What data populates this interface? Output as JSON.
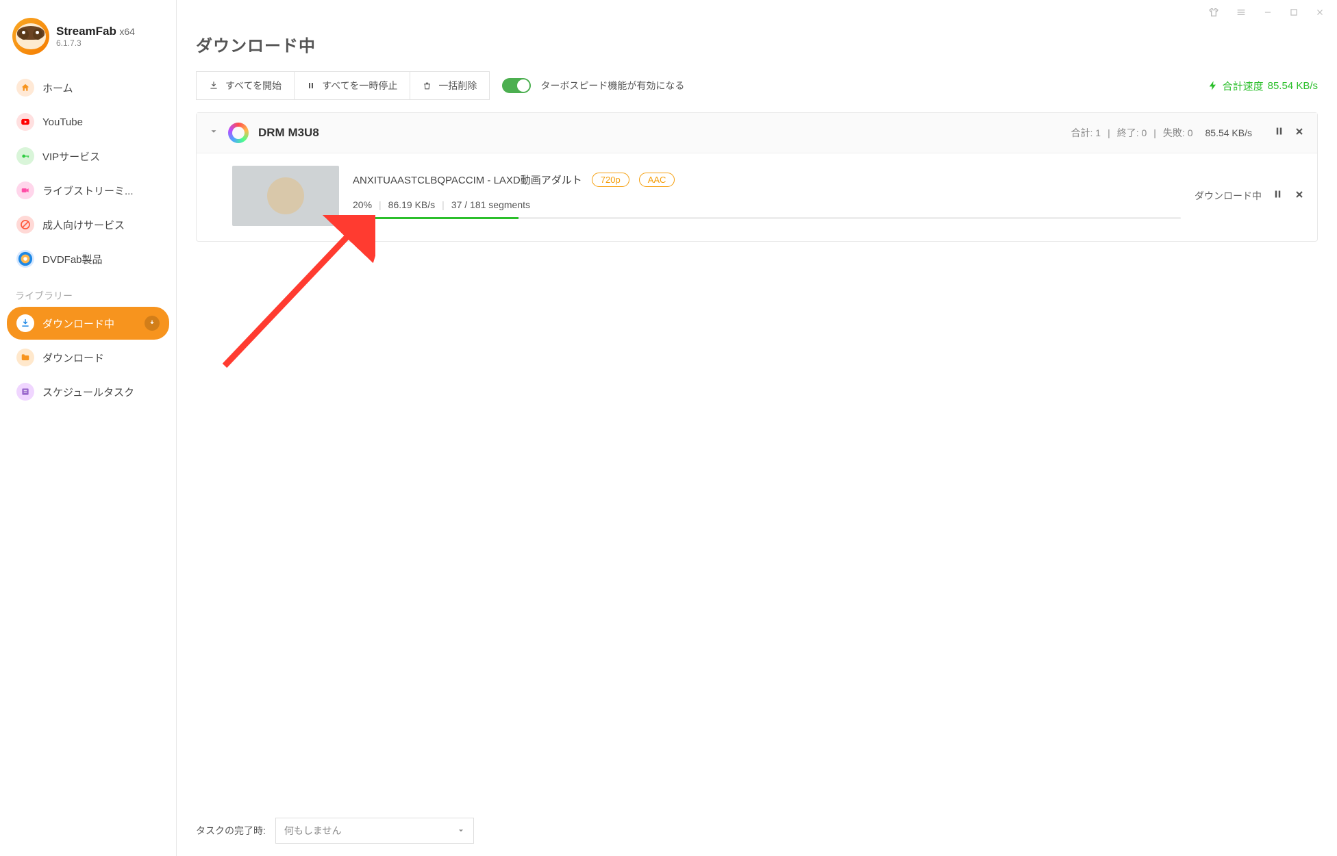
{
  "app": {
    "name": "StreamFab",
    "arch": "x64",
    "version": "6.1.7.3"
  },
  "sidebar": {
    "section_library": "ライブラリー",
    "items": [
      {
        "label": "ホーム"
      },
      {
        "label": "YouTube"
      },
      {
        "label": "VIPサービス"
      },
      {
        "label": "ライブストリーミ..."
      },
      {
        "label": "成人向けサービス"
      },
      {
        "label": "DVDFab製品"
      }
    ],
    "library": [
      {
        "label": "ダウンロード中"
      },
      {
        "label": "ダウンロード"
      },
      {
        "label": "スケジュールタスク"
      }
    ]
  },
  "page": {
    "title": "ダウンロード中"
  },
  "toolbar": {
    "start_all": "すべてを開始",
    "pause_all": "すべてを一時停止",
    "delete_all": "一括削除",
    "turbo_label": "ターボスピード機能が有効になる",
    "total_speed_label": "合計速度",
    "total_speed_value": "85.54 KB/s"
  },
  "group": {
    "name": "DRM M3U8",
    "stats": {
      "total_label": "合計:",
      "total": "1",
      "done_label": "終了:",
      "done": "0",
      "fail_label": "失敗:",
      "fail": "0"
    },
    "speed": "85.54 KB/s"
  },
  "task": {
    "title": "ANXITUAASTCLBQPACCIM - LAXD動画アダルト",
    "badge_res": "720p",
    "badge_audio": "AAC",
    "percent": "20%",
    "speed": "86.19 KB/s",
    "segments": "37 / 181 segments",
    "status": "ダウンロード中",
    "progress_pct": 20
  },
  "footer": {
    "label": "タスクの完了時:",
    "select_value": "何もしません"
  }
}
